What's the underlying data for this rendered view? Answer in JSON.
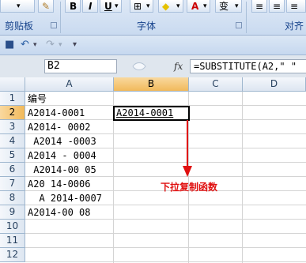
{
  "ribbon": {
    "groups": [
      {
        "label": "剪贴板"
      },
      {
        "label": "字体"
      },
      {
        "label": "对齐"
      }
    ],
    "font_buttons": {
      "bold": "B",
      "italic": "I",
      "underline": "U",
      "font_color": "A",
      "wen": "变"
    }
  },
  "formula_bar": {
    "name_box": "B2",
    "fx_label": "fx",
    "formula": "=SUBSTITUTE(A2,\" \""
  },
  "columns": [
    "A",
    "B",
    "C",
    "D"
  ],
  "rows": [
    "1",
    "2",
    "3",
    "4",
    "5",
    "6",
    "7",
    "8",
    "9",
    "10",
    "11",
    "12"
  ],
  "cells": {
    "A1": "编号",
    "A2": "A2014-0001",
    "A3": "A2014- 0002",
    "A4": " A2014 -0003",
    "A5": "A2014 - 0004",
    "A6": " A2014-00 05",
    "A7": "A20 14-0006",
    "A8": "  A 2014-0007",
    "A9": "A2014-00 08",
    "B2": "A2014-0001"
  },
  "annotation": "下拉复制函数",
  "colors": {
    "annotation": "#e01010",
    "selected_header": "#f1b95b"
  }
}
